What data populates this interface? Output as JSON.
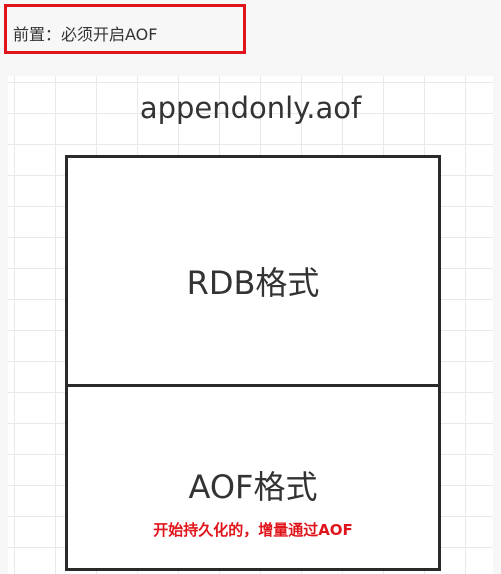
{
  "note": {
    "text": "前置：必须开启AOF"
  },
  "diagram": {
    "file_name": "appendonly.aof",
    "sections": [
      {
        "label": "RDB格式"
      },
      {
        "label": "AOF格式",
        "note": "开始持久化的，增量通过AOF"
      }
    ]
  },
  "colors": {
    "highlight_red": "#e0141b",
    "border": "#2a2a2a",
    "grid": "#e9e9e9"
  }
}
